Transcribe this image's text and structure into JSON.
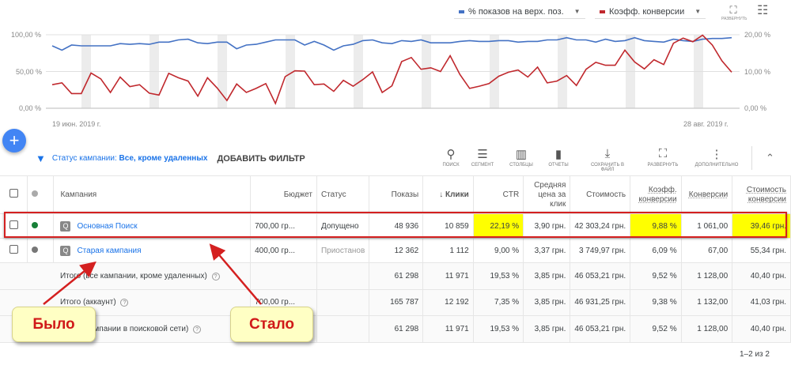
{
  "chart": {
    "legend": [
      {
        "label": "% показов на верх. поз.",
        "color": "#4472c4"
      },
      {
        "label": "Коэфф. конверсии",
        "color": "#c0282d"
      }
    ],
    "expand_label": "РАЗВЕРНУТЬ",
    "left_ticks": [
      "100,00 %",
      "50,00 %",
      "0,00 %"
    ],
    "right_ticks": [
      "20,00 %",
      "10,00 %",
      "0,00 %"
    ],
    "x_start": "19 июн. 2019 г.",
    "x_end": "28 авг. 2019 г."
  },
  "chart_data": {
    "type": "line",
    "x_range": [
      "19 июн. 2019 г.",
      "28 авг. 2019 г."
    ],
    "series": [
      {
        "name": "% показов на верх. поз.",
        "axis": "left",
        "ylim": [
          0,
          100
        ],
        "values": [
          85,
          79,
          86,
          85,
          85,
          85,
          85,
          88,
          87,
          88,
          87,
          90,
          90,
          93,
          94,
          89,
          88,
          90,
          90,
          81,
          86,
          87,
          90,
          93,
          93,
          93,
          86,
          91,
          86,
          79,
          85,
          87,
          92,
          93,
          89,
          88,
          92,
          91,
          93,
          89,
          89,
          89,
          91,
          92,
          91,
          91,
          92,
          92,
          90,
          91,
          91,
          93,
          93,
          96,
          93,
          93,
          90,
          94,
          91,
          92,
          96,
          92,
          91,
          90,
          94,
          92,
          91,
          94,
          95,
          95,
          96
        ]
      },
      {
        "name": "Коэфф. конверсии",
        "axis": "right",
        "ylim": [
          0,
          20
        ],
        "values": [
          6.4,
          6.9,
          4,
          4,
          9.6,
          8,
          4.3,
          8.5,
          5.9,
          6.4,
          4.1,
          3.6,
          9.5,
          8.3,
          7.4,
          3.3,
          8.3,
          5.5,
          2.1,
          6.6,
          4.3,
          5.4,
          6.7,
          1.3,
          8.6,
          10.2,
          10.1,
          6.4,
          6.6,
          4.6,
          7.6,
          6,
          7.8,
          9.9,
          4.3,
          6.1,
          12.7,
          13.8,
          10.6,
          11,
          10,
          14.3,
          9.2,
          5.4,
          6,
          6.7,
          8.7,
          9.8,
          10.4,
          8.5,
          11.2,
          6.9,
          7.4,
          8.9,
          6.2,
          10.6,
          12.5,
          11.7,
          11.7,
          15.8,
          12.6,
          10.7,
          13.2,
          11.9,
          17.7,
          19.1,
          18.1,
          19.9,
          17.2,
          12.9,
          9.8
        ]
      }
    ]
  },
  "filter": {
    "label": "Статус кампании:",
    "value": "Все, кроме удаленных",
    "add": "ДОБАВИТЬ ФИЛЬТР"
  },
  "toolbar": [
    {
      "icon": "search-icon",
      "label": "ПОИСК"
    },
    {
      "icon": "segment-icon",
      "label": "СЕГМЕНТ"
    },
    {
      "icon": "columns-icon",
      "label": "СТОЛБЦЫ"
    },
    {
      "icon": "reports-icon",
      "label": "ОТЧЕТЫ"
    },
    {
      "icon": "download-icon",
      "label": "СОХРАНИТЬ В ФАЙЛ"
    },
    {
      "icon": "expand-icon",
      "label": "РАЗВЕРНУТЬ"
    },
    {
      "icon": "more-icon",
      "label": "ДОПОЛНИТЕЛЬНО"
    }
  ],
  "table": {
    "headers": [
      "Кампания",
      "Бюджет",
      "Статус",
      "Показы",
      "Клики",
      "CTR",
      "Средняя цена за клик",
      "Стоимость",
      "Коэфф. конверсии",
      "Конверсии",
      "Стоимость конверсии"
    ],
    "rows": [
      {
        "name": "Основная Поиск",
        "budget": "700,00 гр...",
        "status": "Допущено",
        "impr": "48 936",
        "clicks": "10 859",
        "ctr": "22,19 %",
        "cpc": "3,90 грн.",
        "cost": "42 303,24 грн.",
        "cr": "9,88 %",
        "conv": "1 061,00",
        "cpa": "39,46 грн.",
        "status_color": "#188038"
      },
      {
        "name": "Старая кампания",
        "budget": "400,00 гр...",
        "status": "Приостанов",
        "impr": "12 362",
        "clicks": "1 112",
        "ctr": "9,00 %",
        "cpc": "3,37 грн.",
        "cost": "3 749,97 грн.",
        "cr": "6,09 %",
        "conv": "67,00",
        "cpa": "55,34 грн.",
        "status_color": "#777777"
      }
    ],
    "totals": [
      {
        "label": "Итого (все кампании, кроме удаленных)",
        "budget": "",
        "impr": "61 298",
        "clicks": "11 971",
        "ctr": "19,53 %",
        "cpc": "3,85 грн.",
        "cost": "46 053,21 грн.",
        "cr": "9,52 %",
        "conv": "1 128,00",
        "cpa": "40,40 грн."
      },
      {
        "label": "Итого (аккаунт)",
        "budget": "700,00 гр...",
        "impr": "165 787",
        "clicks": "12 192",
        "ctr": "7,35 %",
        "cpc": "3,85 грн.",
        "cost": "46 931,25 грн.",
        "cr": "9,38 %",
        "conv": "1 132,00",
        "cpa": "41,03 грн."
      },
      {
        "label": "Итого (кампании в поисковой сети)",
        "budget": "",
        "impr": "61 298",
        "clicks": "11 971",
        "ctr": "19,53 %",
        "cpc": "3,85 грн.",
        "cost": "46 053,21 грн.",
        "cr": "9,52 %",
        "conv": "1 128,00",
        "cpa": "40,40 грн."
      }
    ]
  },
  "pagination": "1–2 из 2",
  "annotations": {
    "before": "Было",
    "after": "Стало"
  }
}
